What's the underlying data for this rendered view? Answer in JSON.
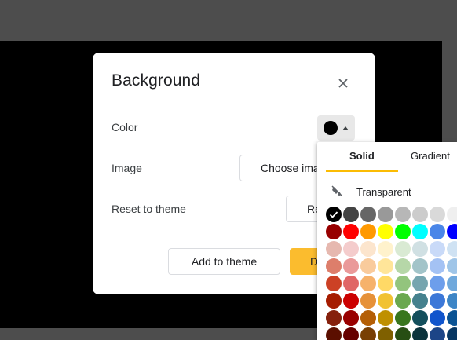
{
  "dialog": {
    "title": "Background",
    "color_label": "Color",
    "image_label": "Image",
    "reset_label": "Reset to theme",
    "choose_image_label": "Choose ima",
    "reset_button_label": "Re",
    "add_to_theme_label": "Add to theme",
    "done_label": "D",
    "selected_color": "#000000"
  },
  "palette": {
    "tabs": [
      "Solid",
      "Gradient"
    ],
    "active_tab": "Solid",
    "transparent_label": "Transparent",
    "selected_color": "#000000",
    "colors": [
      [
        "#000000",
        "#434343",
        "#666666",
        "#999999",
        "#b7b7b7",
        "#cccccc",
        "#d9d9d9",
        "#efefef"
      ],
      [
        "#980000",
        "#ff0000",
        "#ff9900",
        "#ffff00",
        "#00ff00",
        "#00ffff",
        "#4a86e8",
        "#0000ff"
      ],
      [
        "#e6b8af",
        "#f4cccc",
        "#fce5cd",
        "#fff2cc",
        "#d9ead3",
        "#d0e0e3",
        "#c9daf8",
        "#cfe2f3"
      ],
      [
        "#dd7e6b",
        "#ea9999",
        "#f9cb9c",
        "#ffe599",
        "#b6d7a8",
        "#a2c4c9",
        "#a4c2f4",
        "#9fc5e8"
      ],
      [
        "#cc4125",
        "#e06666",
        "#f6b26b",
        "#ffd966",
        "#93c47d",
        "#76a5af",
        "#6d9eeb",
        "#6fa8dc"
      ],
      [
        "#a61c00",
        "#cc0000",
        "#e69138",
        "#f1c232",
        "#6aa84f",
        "#45818e",
        "#3c78d8",
        "#3d85c6"
      ],
      [
        "#85200c",
        "#990000",
        "#b45f06",
        "#bf9000",
        "#38761d",
        "#134f5c",
        "#1155cc",
        "#0b5394"
      ],
      [
        "#5b0f00",
        "#660000",
        "#783f04",
        "#7f6000",
        "#274e13",
        "#0c343d",
        "#1c4587",
        "#073763"
      ]
    ]
  },
  "colors": {
    "accent": "#fbbc04",
    "done_button": "#fbbc2e",
    "slide_background": "#000000",
    "workspace": "#4d4d4d"
  }
}
